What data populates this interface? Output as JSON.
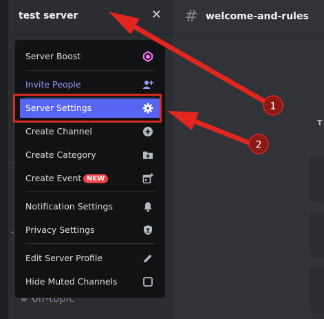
{
  "server": {
    "name": "test server",
    "close_glyph": "✕"
  },
  "channel": {
    "hash": "#",
    "title": "welcome-and-rules"
  },
  "menu": {
    "items": [
      {
        "label": "Server Boost",
        "icon": "boost-gem-icon",
        "color": "#dbdee1"
      },
      {
        "label": "Invite People",
        "icon": "add-person-icon",
        "color": "#949cf7"
      },
      {
        "label": "Server Settings",
        "icon": "gear-icon",
        "color": "#ffffff"
      },
      {
        "label": "Create Channel",
        "icon": "plus-circle-icon",
        "color": "#dbdee1"
      },
      {
        "label": "Create Category",
        "icon": "folder-plus-icon",
        "color": "#dbdee1"
      },
      {
        "label": "Create Event",
        "icon": "calendar-plus-icon",
        "color": "#dbdee1",
        "badge": "NEW"
      },
      {
        "label": "Notification Settings",
        "icon": "bell-icon",
        "color": "#dbdee1"
      },
      {
        "label": "Privacy Settings",
        "icon": "shield-icon",
        "color": "#dbdee1"
      },
      {
        "label": "Edit Server Profile",
        "icon": "pencil-icon",
        "color": "#dbdee1"
      },
      {
        "label": "Hide Muted Channels",
        "icon": "checkbox-icon",
        "color": "#dbdee1"
      }
    ]
  },
  "sidebar": {
    "partial_channel": "off-topic",
    "caret": "⌄"
  },
  "main": {
    "partial_heading": "T"
  },
  "annotations": {
    "markers": [
      {
        "label": "1"
      },
      {
        "label": "2"
      }
    ],
    "arrow_color": "#e0261f",
    "marker_color": "#8b1a14"
  },
  "colors": {
    "accent": "#5865f2",
    "background": "#313338",
    "sidebar": "#2b2d31",
    "menu": "#111214",
    "badge": "#f23f43",
    "boost": "#ff73fa"
  }
}
